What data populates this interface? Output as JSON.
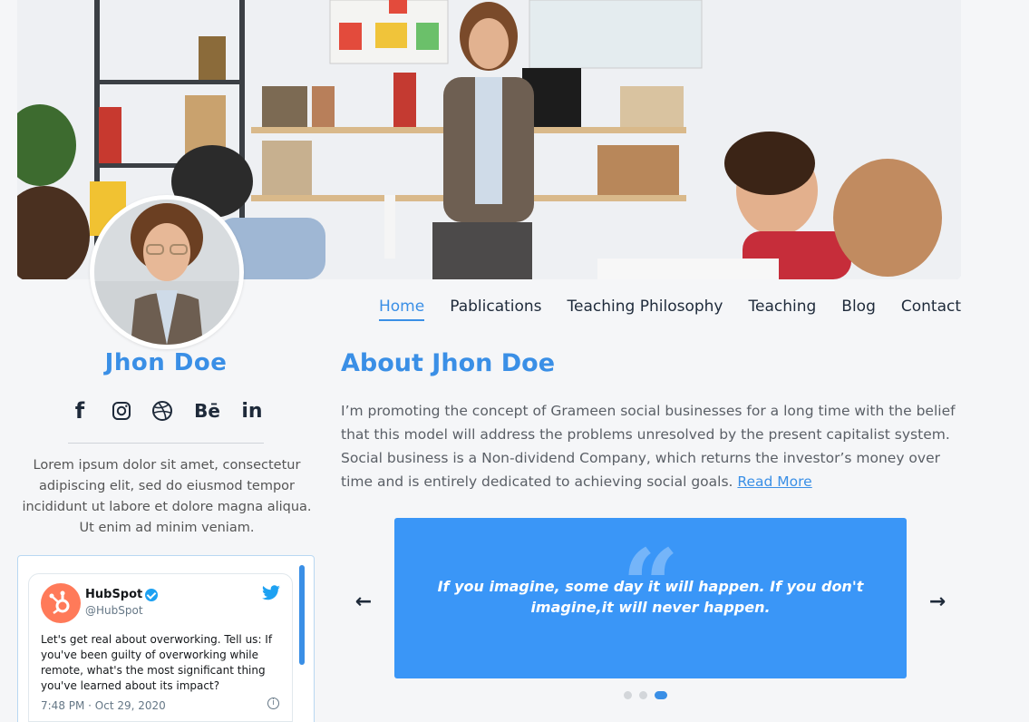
{
  "profile": {
    "name": "Jhon Doe",
    "bio": "Lorem ipsum dolor sit amet, consectetur adipiscing elit, sed do eiusmod tempor incididunt ut labore et dolore magna aliqua. Ut enim ad minim veniam."
  },
  "nav": {
    "items": [
      {
        "label": "Home",
        "active": true
      },
      {
        "label": "Pablications",
        "active": false
      },
      {
        "label": "Teaching Philosophy",
        "active": false
      },
      {
        "label": "Teaching",
        "active": false
      },
      {
        "label": "Blog",
        "active": false
      },
      {
        "label": "Contact",
        "active": false
      }
    ]
  },
  "social": {
    "icons": [
      "facebook-icon",
      "instagram-icon",
      "dribbble-icon",
      "behance-icon",
      "linkedin-icon"
    ],
    "behance_text": "Bē",
    "linkedin_text": "in",
    "facebook_text": "f"
  },
  "about": {
    "title": "About Jhon Doe",
    "text": "I’m promoting the concept of Grameen social businesses for a long time with the belief that this model will address the problems unresolved by the present capitalist system. Social business is a Non-dividend Company, which returns the investor’s money over time and is entirely dedicated to achieving social goals.",
    "read_more": "Read More"
  },
  "tweet": {
    "account_name": "HubSpot",
    "handle": "@HubSpot",
    "text": "Let's get real about overworking. Tell us: If you've been guilty of overworking while remote, what's the most significant thing you've learned about its impact?",
    "time": "7:48 PM · Oct 29, 2020",
    "info_glyph": "i"
  },
  "carousel": {
    "quote": "If you imagine, some day it will happen. If you don't imagine,it will never happen.",
    "quote_glyph": "“",
    "prev_glyph": "←",
    "next_glyph": "→",
    "slide_count": 3,
    "active_slide": 3
  },
  "colors": {
    "accent": "#3a8fe6",
    "slide_bg": "#3a96f7",
    "text_dark": "#1e2a3a",
    "hubspot_orange": "#ff7a59",
    "twitter_blue": "#1da1f2"
  }
}
